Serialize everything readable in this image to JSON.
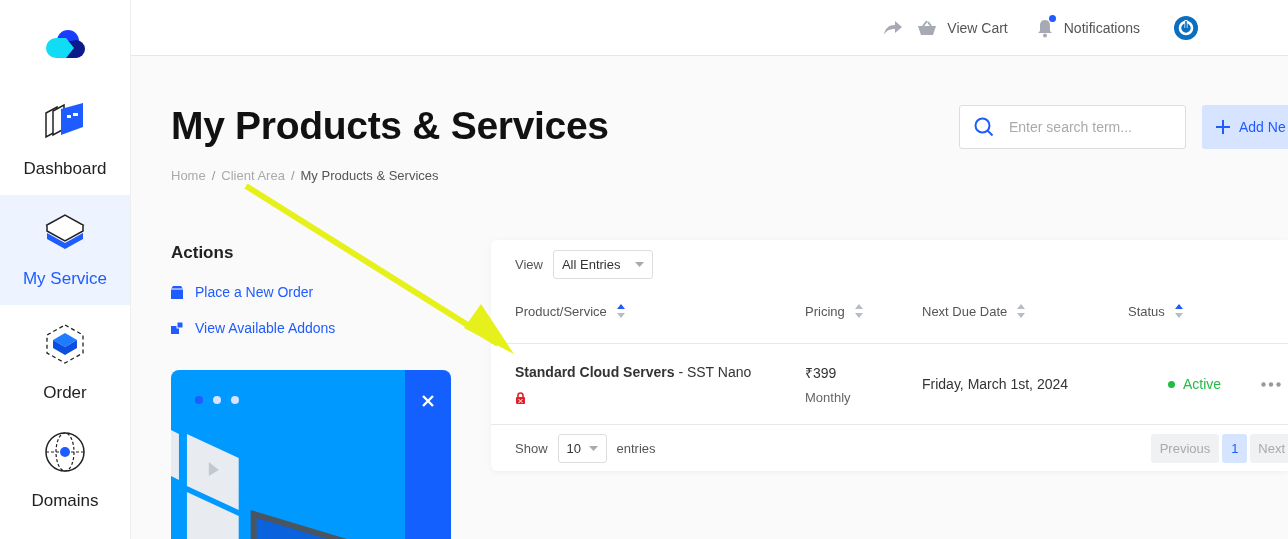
{
  "sidebar": {
    "items": [
      {
        "label": "Dashboard",
        "kind": "dashboard",
        "selected": false
      },
      {
        "label": "My Service",
        "kind": "service",
        "selected": true
      },
      {
        "label": "Order",
        "kind": "order",
        "selected": false
      },
      {
        "label": "Domains",
        "kind": "domains",
        "selected": false
      }
    ]
  },
  "topbar": {
    "cart": "View Cart",
    "notifications": "Notifications",
    "has_unread": true
  },
  "page": {
    "title": "My Products & Services",
    "breadcrumb": [
      {
        "label": "Home",
        "current": false
      },
      {
        "separator": "/",
        "label": "Client Area",
        "current": false
      },
      {
        "separator": "/",
        "label": "My Products & Services",
        "current": true
      }
    ],
    "search": {
      "placeholder": "Enter search term..."
    },
    "add_button": "Add Ne"
  },
  "actions": {
    "title": "Actions",
    "links": [
      {
        "label": "Place a New Order",
        "kind": "order"
      },
      {
        "label": "View Available Addons",
        "kind": "addons"
      }
    ]
  },
  "promo": {
    "slides": [
      {
        "selected": true
      },
      {
        "selected": false
      },
      {
        "selected": false
      }
    ]
  },
  "table": {
    "view_label": "View",
    "view_value": "All Entries",
    "columns": [
      {
        "label": "Product/Service",
        "sorted": true
      },
      {
        "label": "Pricing",
        "sorted": false
      },
      {
        "label": "Next Due Date",
        "sorted": false
      },
      {
        "label": "Status",
        "sorted": true
      }
    ],
    "rows": [
      {
        "product": "Standard Cloud Servers",
        "plan": " - SST Nano",
        "locked": true,
        "price": "₹399",
        "cycle": "Monthly",
        "due": "Friday, March 1st, 2024",
        "status": "Active",
        "color": "#22bb44"
      }
    ],
    "show_label": "Show",
    "page_size": "10",
    "entries_label": "entries",
    "pagination": [
      {
        "label": "Previous",
        "kind": "nav",
        "selected": false
      },
      {
        "label": "1",
        "kind": "page",
        "selected": true
      },
      {
        "label": "Next",
        "kind": "nav",
        "selected": false
      }
    ]
  }
}
